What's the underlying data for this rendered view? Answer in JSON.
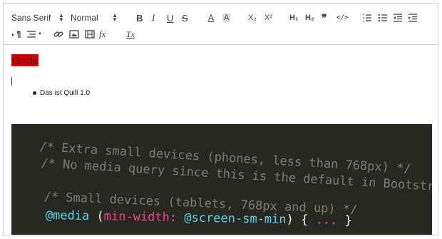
{
  "toolbar": {
    "font_picker": "Sans Serif",
    "size_picker": "Normal",
    "bold": "B",
    "italic": "I",
    "underline": "U",
    "strike": "S",
    "color": "A",
    "background": "A",
    "subscript": "X₂",
    "superscript": "X²",
    "header1": "H₁",
    "header2": "H₂",
    "blockquote": "❞",
    "code": "</>",
    "formula": "fx",
    "clean": "Tx"
  },
  "editor": {
    "link_text": "t3n.de",
    "list_items": [
      "Das ist Quill 1.0"
    ]
  },
  "code_image": {
    "lines": [
      "/* Extra small devices (phones, less than 768px) */",
      "/* No media query since this is the default in Bootstrap */",
      "/* Small devices (tablets, 768px and up) */"
    ],
    "media_keyword": "@media",
    "media_open": "(",
    "media_prop": "min-width:",
    "media_var": "@screen-sm-min",
    "media_close": ")",
    "brace_open": "{",
    "ellipsis": "...",
    "brace_close": "}"
  },
  "colors": {
    "link_background": "#cc0000",
    "code_background": "#272822",
    "comment": "#7c7c72",
    "keyword": "#5fd1e8",
    "property": "#f0448f"
  },
  "icons": [
    "align-icon",
    "bullet-list-icon",
    "ordered-list-icon",
    "indent-icon",
    "outdent-icon",
    "link-icon",
    "image-icon",
    "video-icon",
    "rtl-icon"
  ]
}
